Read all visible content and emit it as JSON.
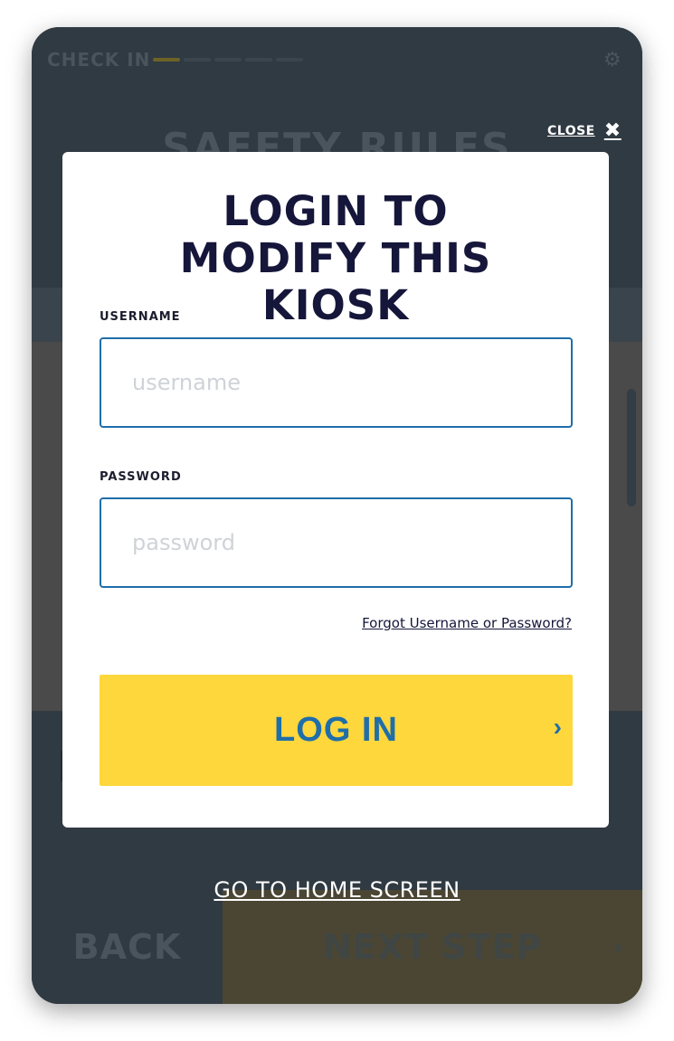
{
  "background": {
    "header": {
      "check_in_label": "CHECK IN",
      "progress_steps": [
        true,
        false,
        false,
        false,
        false
      ],
      "settings_icon": "gear-icon",
      "page_title": "SAFETY RULES"
    },
    "footer": {
      "back_label": "BACK",
      "next_label": "NEXT STEP",
      "next_icon": "chevron-right-icon"
    }
  },
  "modal": {
    "close_label": "CLOSE",
    "close_icon": "close-icon",
    "title": "LOGIN TO MODIFY THIS KIOSK",
    "username": {
      "label": "USERNAME",
      "placeholder": "username",
      "value": ""
    },
    "password": {
      "label": "PASSWORD",
      "placeholder": "password",
      "value": ""
    },
    "forgot_link": "Forgot Username or Password?",
    "login_button": "LOG IN",
    "login_icon": "chevron-right-icon"
  },
  "home_link": "GO TO HOME SCREEN",
  "colors": {
    "accent_yellow": "#fdd73c",
    "accent_blue": "#1f6eaa",
    "title_navy": "#15163a",
    "overlay_dark": "#303a42"
  }
}
